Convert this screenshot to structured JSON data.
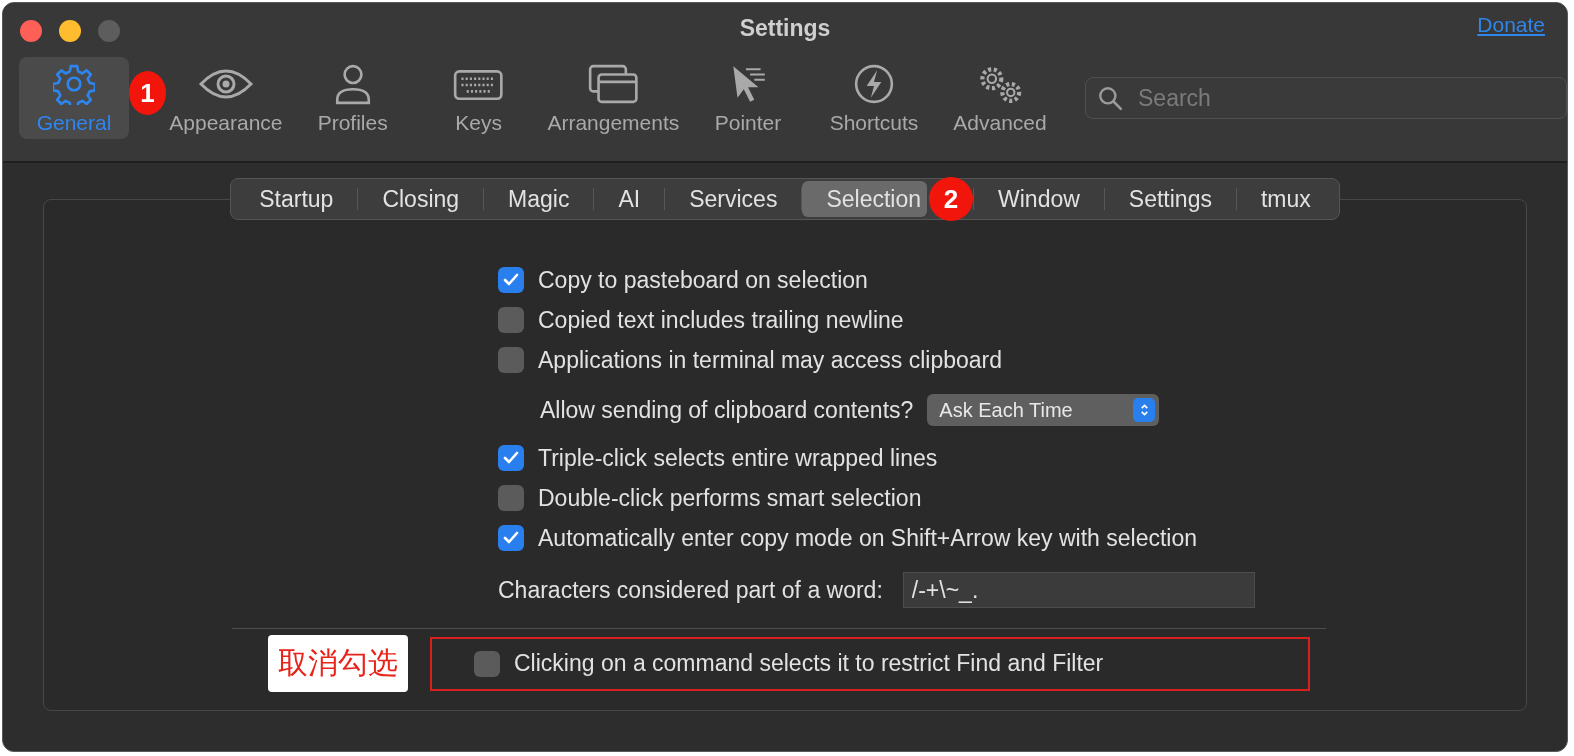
{
  "window": {
    "title": "Settings"
  },
  "donate_link": "Donate",
  "toolbar": [
    {
      "label": "General",
      "selected": true,
      "badge": "1"
    },
    {
      "label": "Appearance",
      "selected": false
    },
    {
      "label": "Profiles",
      "selected": false
    },
    {
      "label": "Keys",
      "selected": false
    },
    {
      "label": "Arrangements",
      "selected": false
    },
    {
      "label": "Pointer",
      "selected": false
    },
    {
      "label": "Shortcuts",
      "selected": false
    },
    {
      "label": "Advanced",
      "selected": false
    }
  ],
  "search": {
    "placeholder": "Search"
  },
  "tabs": [
    {
      "label": "Startup",
      "selected": false
    },
    {
      "label": "Closing",
      "selected": false
    },
    {
      "label": "Magic",
      "selected": false
    },
    {
      "label": "AI",
      "selected": false
    },
    {
      "label": "Services",
      "selected": false
    },
    {
      "label": "Selection",
      "selected": true,
      "badge": "2"
    },
    {
      "label": "Window",
      "selected": false
    },
    {
      "label": "Settings",
      "selected": false
    },
    {
      "label": "tmux",
      "selected": false
    }
  ],
  "options": [
    {
      "kind": "checkbox",
      "label": "Copy to pasteboard on selection",
      "checked": true
    },
    {
      "kind": "checkbox",
      "label": "Copied text includes trailing newline",
      "checked": false
    },
    {
      "kind": "checkbox",
      "label": "Applications in terminal may access clipboard",
      "checked": false
    },
    {
      "kind": "dropdown",
      "label": "Allow sending of clipboard contents?",
      "value": "Ask Each Time"
    },
    {
      "kind": "checkbox",
      "label": "Triple-click selects entire wrapped lines",
      "checked": true
    },
    {
      "kind": "checkbox",
      "label": "Double-click performs smart selection",
      "checked": false
    },
    {
      "kind": "checkbox",
      "label": "Automatically enter copy mode on Shift+Arrow key with selection",
      "checked": true
    },
    {
      "kind": "text_field",
      "label": "Characters considered part of a word:",
      "value": "/-+\\~_."
    }
  ],
  "highlighted_option": {
    "kind": "checkbox",
    "label": "Clicking on a command selects it to restrict Find and Filter",
    "checked": false
  },
  "annotation": {
    "note": "取消勾选"
  }
}
